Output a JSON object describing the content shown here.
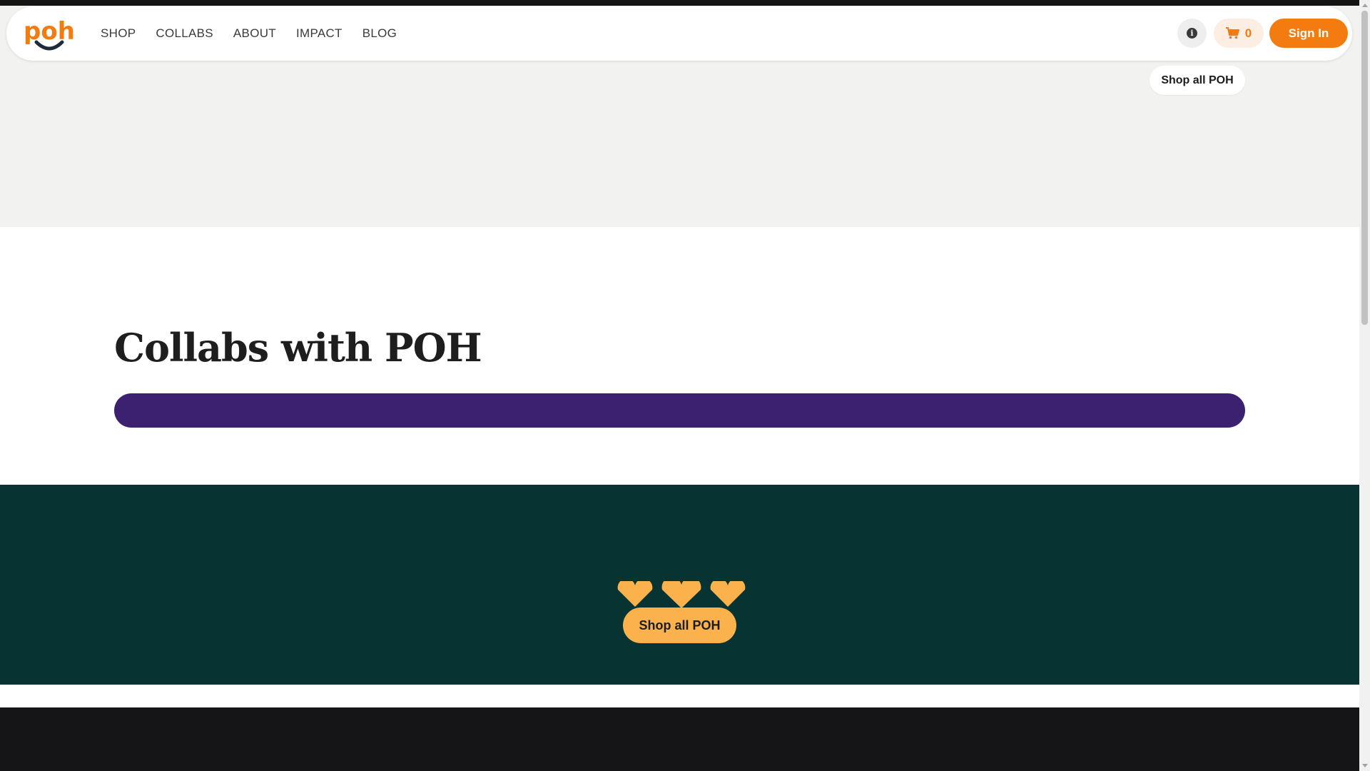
{
  "brand": {
    "logo_text": "poh",
    "accent_color": "#f47b0f"
  },
  "nav": {
    "links": [
      "SHOP",
      "COLLABS",
      "ABOUT",
      "IMPACT",
      "BLOG"
    ],
    "info_icon": "info-icon",
    "cart_icon": "cart-icon",
    "cart_count": "0",
    "sign_in_label": "Sign In"
  },
  "hero": {
    "shop_all_label": "Shop all POH"
  },
  "collabs": {
    "title": "Collabs with POH",
    "bar_color": "#3c2170"
  },
  "cta": {
    "shop_all_label": "Shop all POH",
    "background": "#073433",
    "button_color": "#fbb24d"
  }
}
